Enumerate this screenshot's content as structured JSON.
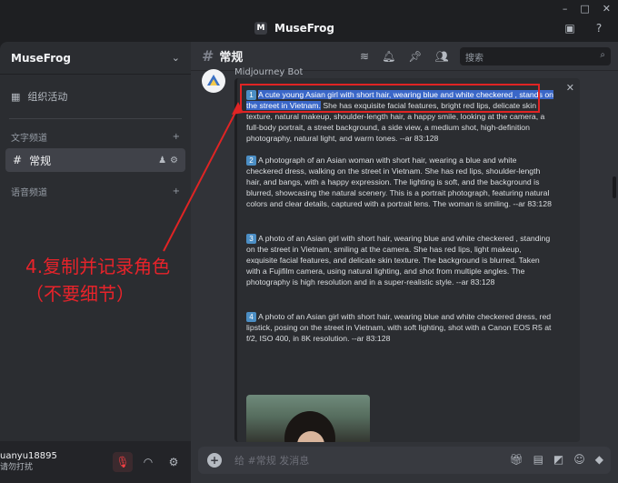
{
  "app": {
    "title": "MuseFrog",
    "logo_letter": "M"
  },
  "window_controls": [
    "–",
    "□",
    "✕"
  ],
  "sidebar": {
    "server_name": "MuseFrog",
    "events_label": "组织活动",
    "text_category": "文字频道",
    "active_channel": "常规",
    "voice_category": "语音频道"
  },
  "user": {
    "name": "uanyu18895",
    "status": "请勿打扰"
  },
  "channel_header": {
    "title": "常规",
    "search_placeholder": "搜索"
  },
  "message": {
    "author": "Midjourney Bot",
    "prompts": [
      {
        "number": "1",
        "highlighted": "A cute young Asian girl with short hair, wearing blue and white checkered , stands on the street in Vietnam.",
        "rest": " She has exquisite facial features, bright red lips, delicate skin texture, natural makeup, shoulder-length hair, a happy smile, looking at the camera, a full-body portrait, a street background, a side view, a medium shot, high-definition photography, natural light, and warm tones. --ar 83:128"
      },
      {
        "number": "2",
        "highlighted": "",
        "rest": "A photograph of an Asian woman with short hair, wearing a blue and white checkered dress, walking on the street in Vietnam. She has red lips, shoulder-length hair, and bangs, with a happy expression. The lighting is soft, and the background is blurred, showcasing the natural scenery. This is a portrait photograph, featuring natural colors and clear details, captured with a portrait lens. The woman is smiling. --ar 83:128"
      },
      {
        "number": "3",
        "highlighted": "",
        "rest": "A photo of an Asian girl with short hair, wearing blue and white checkered , standing on the street in Vietnam, smiling at the camera. She has red lips, light makeup, exquisite facial features, and delicate skin texture. The background is blurred. Taken with a Fujifilm camera, using natural lighting, and shot from multiple angles. The photography is high resolution and in a super-realistic style. --ar 83:128"
      },
      {
        "number": "4",
        "highlighted": "",
        "rest": "A photo of an Asian girl with short hair, wearing blue and white checkered dress, red lipstick, posing on the street in Vietnam, with soft lighting, shot with a Canon EOS R5 at f/2, ISO 400, in 8K resolution. --ar 83:128"
      }
    ]
  },
  "composer": {
    "placeholder": "给 #常规 发消息"
  },
  "annotation": {
    "line1": "4.复制并记录角色",
    "line2": "（不要细节）",
    "color": "#e8232a"
  },
  "colors": {
    "highlight": "#3a67c8",
    "accent_red": "#e02424",
    "number_badge": "#4b8ec4"
  }
}
